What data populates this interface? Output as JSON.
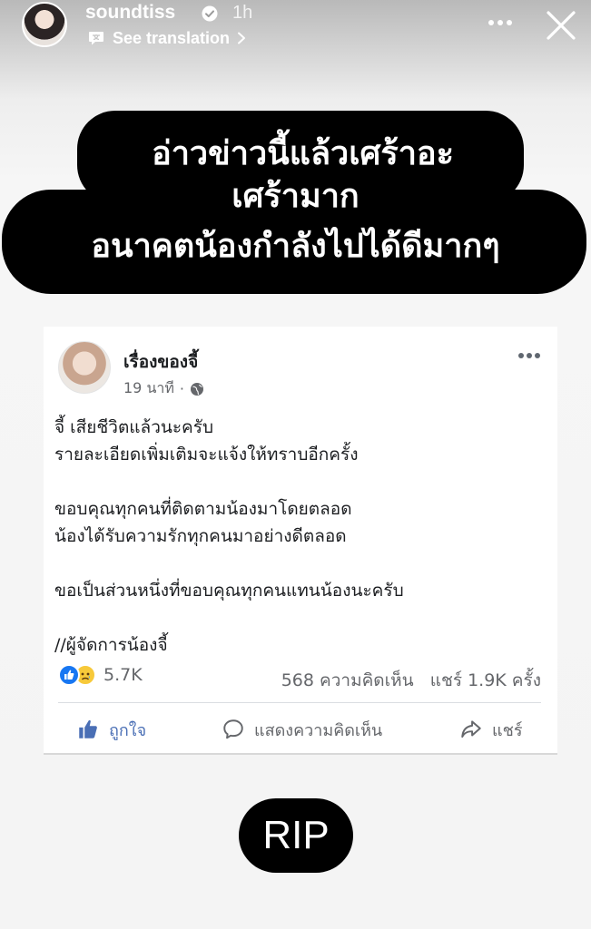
{
  "story": {
    "username": "soundtiss",
    "time_ago": "1h",
    "see_translation": "See translation",
    "icons": [
      "verified-badge-icon",
      "translate-icon",
      "chevron-right-icon",
      "more-icon",
      "close-icon"
    ]
  },
  "caption": {
    "line1": "อ่าวข่าวนี้แล้วเศร้าอะ",
    "line2": "เศร้ามาก",
    "line3": "อนาคตน้องกำลังไปได้ดีมากๆ"
  },
  "post": {
    "author": "เรื่องของจี้",
    "time": "19 นาที",
    "separator": "·",
    "body": [
      "จี้ เสียชีวิตแล้วนะครับ",
      "รายละเอียดเพิ่มเติมจะแจ้งให้ทราบอีกครั้ง",
      "ขอบคุณทุกคนที่ติดตามน้องมาโดยตลอด",
      "น้องได้รับความรักทุกคนมาอย่างดีตลอด",
      "ขอเป็นส่วนหนึ่งที่ขอบคุณทุกคนแทนน้องนะครับ",
      "//ผู้จัดการน้องจี้"
    ],
    "reactions_count": "5.7K",
    "comments": "568 ความคิดเห็น",
    "shares": "แชร์ 1.9K ครั้ง",
    "actions": {
      "like": "ถูกใจ",
      "comment": "แสดงความคิดเห็น",
      "share": "แชร์"
    },
    "colors": {
      "like_blue": "#1877f2",
      "sad_yellow": "#f7c93a",
      "meta_gray": "#65676b"
    }
  },
  "sticker": {
    "text": "RIP"
  }
}
